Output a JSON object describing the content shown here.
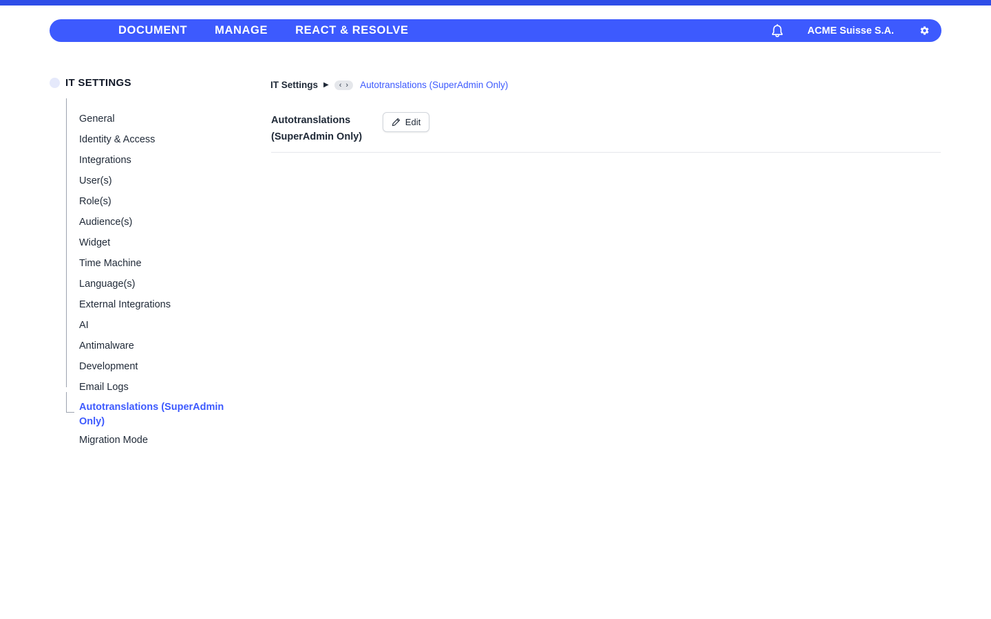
{
  "colors": {
    "brand": "#3d5afe",
    "top_strip": "#2f4ee8",
    "active_text": "#3d5afe"
  },
  "navbar": {
    "tabs": [
      {
        "label": "DOCUMENT"
      },
      {
        "label": "MANAGE"
      },
      {
        "label": "REACT & RESOLVE"
      }
    ],
    "notification_icon": "bell-icon",
    "org_name": "ACME Suisse S.A.",
    "settings_icon": "gear-icon"
  },
  "sidebar": {
    "title": "IT SETTINGS",
    "items": [
      {
        "label": "General"
      },
      {
        "label": "Identity & Access"
      },
      {
        "label": "Integrations"
      },
      {
        "label": "User(s)"
      },
      {
        "label": "Role(s)"
      },
      {
        "label": "Audience(s)"
      },
      {
        "label": "Widget"
      },
      {
        "label": "Time Machine"
      },
      {
        "label": "Language(s)"
      },
      {
        "label": "External Integrations"
      },
      {
        "label": "AI"
      },
      {
        "label": "Antimalware"
      },
      {
        "label": "Development"
      },
      {
        "label": "Email Logs"
      },
      {
        "label": "Autotranslations (SuperAdmin Only)",
        "active": true
      },
      {
        "label": "Migration Mode"
      }
    ]
  },
  "breadcrumb": {
    "root": "IT Settings",
    "separator_icon": "play-arrow-icon",
    "prev_icon": "chevron-left-icon",
    "next_icon": "chevron-right-icon",
    "current": "Autotranslations (SuperAdmin Only)"
  },
  "content": {
    "title": "Autotranslations (SuperAdmin Only)",
    "edit_label": "Edit",
    "edit_icon": "pencil-icon"
  }
}
